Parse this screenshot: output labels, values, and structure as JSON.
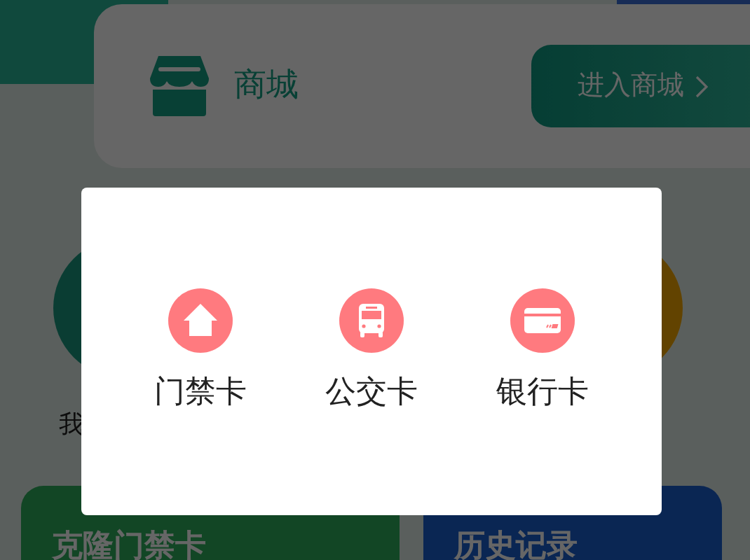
{
  "mall": {
    "title": "商城",
    "button": "进入商城"
  },
  "features": [
    {
      "label": "我",
      "kind": "green"
    },
    {
      "kind": "orange"
    }
  ],
  "shortcuts": [
    {
      "label": "克隆门禁卡",
      "kind": "green"
    },
    {
      "label": "历史记录",
      "kind": "blue"
    }
  ],
  "dialog": {
    "options": [
      {
        "label": "门禁卡",
        "kind": "home"
      },
      {
        "label": "公交卡",
        "kind": "bus"
      },
      {
        "label": "银行卡",
        "kind": "card"
      }
    ]
  }
}
